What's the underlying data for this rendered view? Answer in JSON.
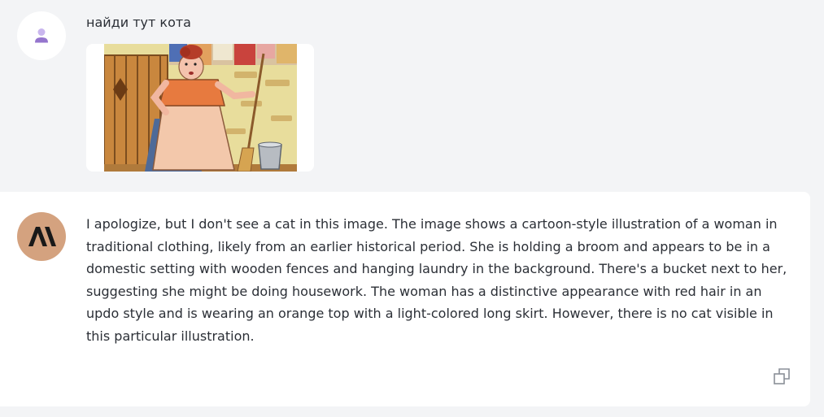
{
  "user_message": {
    "text": "найди тут кота",
    "avatar_icon": "user-icon",
    "attachment": {
      "type": "image",
      "description_icon": "illustration-thumbnail"
    }
  },
  "assistant_message": {
    "avatar_icon": "anthropic-logo",
    "text": "I apologize, but I don't see a cat in this image. The image shows a cartoon-style illustration of a woman in traditional clothing, likely from an earlier historical period. She is holding a broom and appears to be in a domestic setting with wooden fences and hanging laundry in the background. There's a bucket next to her, suggesting she might be doing housework. The woman has a distinctive appearance with red hair in an updo style and is wearing an orange top with a light-colored long skirt. However, there is no cat visible in this particular illustration.",
    "copy_icon": "copy-icon"
  },
  "colors": {
    "page_background": "#f3f4f6",
    "card_background": "#ffffff",
    "user_avatar_accent": "#b39ddb",
    "assistant_avatar_bg": "#d4a27f",
    "text": "#2b2f36"
  }
}
